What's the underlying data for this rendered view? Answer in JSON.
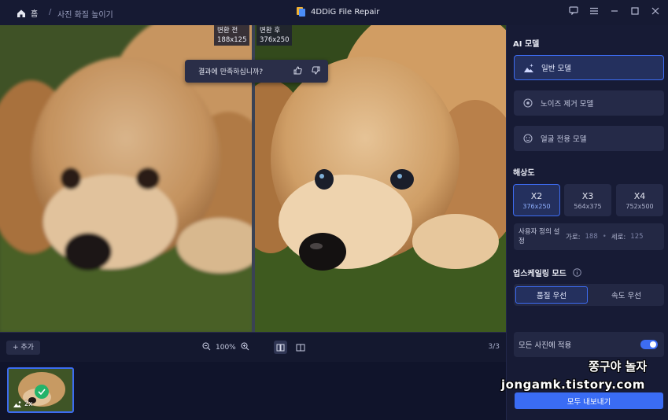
{
  "titlebar": {
    "home_label": "홈",
    "crumb_separator": "/",
    "crumb": "사진 화질 높이기",
    "app_title": "4DDiG File Repair",
    "icons": [
      "feedback-icon",
      "menu-icon",
      "minimize-icon",
      "maximize-icon",
      "close-icon"
    ]
  },
  "preview": {
    "before_label": "변환 전",
    "before_size": "188x125",
    "after_label": "변환 후",
    "after_size": "376x250",
    "feedback_question": "결과에 만족하십니까?"
  },
  "toolbar": {
    "add_label": "+ 추가",
    "zoom_level": "100%",
    "page_count": "3/3"
  },
  "filmstrip": {
    "items": [
      {
        "scale": "2x"
      }
    ]
  },
  "panel": {
    "ai_model_title": "AI 모델",
    "models": [
      {
        "label": "일반 모델",
        "active": true
      },
      {
        "label": "노이즈 제거 모델",
        "active": false
      },
      {
        "label": "얼굴 전용 모델",
        "active": false
      }
    ],
    "resolution_title": "해상도",
    "resolutions": [
      {
        "level": "X2",
        "size": "376x250",
        "active": true
      },
      {
        "level": "X3",
        "size": "564x375",
        "active": false
      },
      {
        "level": "X4",
        "size": "752x500",
        "active": false
      }
    ],
    "custom": {
      "label": "사용자 정의 설정",
      "width_label": "가로:",
      "width_value": "188",
      "height_label": "세로:",
      "height_value": "125"
    },
    "upscale_title": "업스케일링 모드",
    "modes": [
      {
        "label": "품질 우선",
        "active": true
      },
      {
        "label": "속도 우선",
        "active": false
      }
    ],
    "apply_all_label": "모든 사진에 적용",
    "apply_all_on": true,
    "export_label": "모두 내보내기"
  },
  "watermark": {
    "name": "쫑구야 놀자",
    "site": "jongamk.tistory.com"
  },
  "colors": {
    "accent": "#3d6cf2",
    "panel_bg": "#171b35",
    "app_bg": "#10142b"
  }
}
